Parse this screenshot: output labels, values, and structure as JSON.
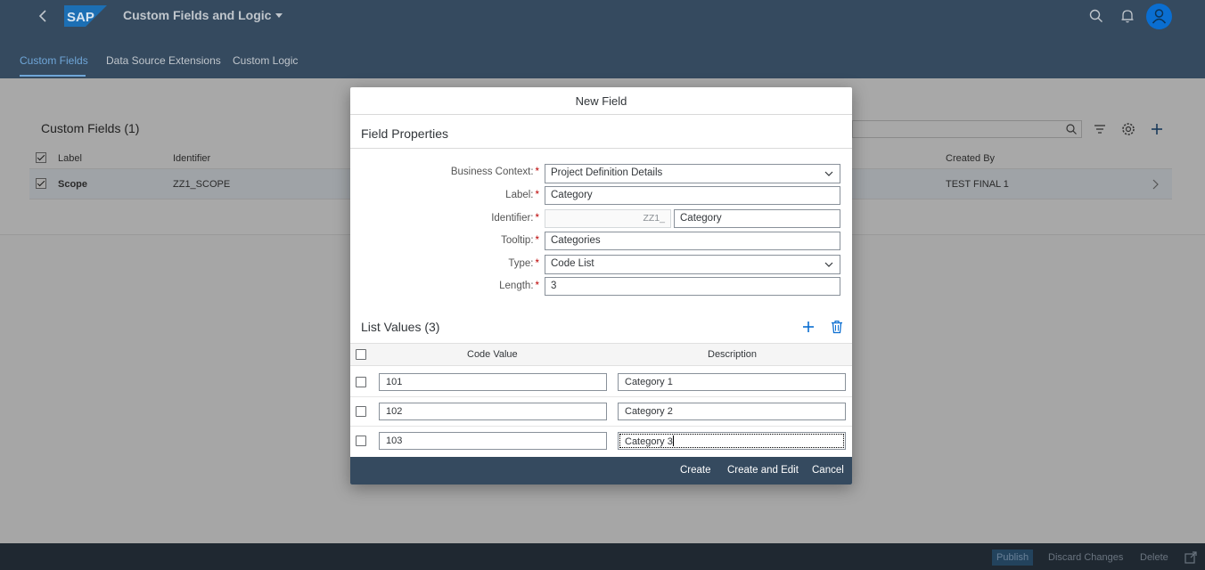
{
  "shell": {
    "app_title": "Custom Fields and Logic",
    "logo_text": "SAP"
  },
  "tabs": [
    {
      "label": "Custom Fields"
    },
    {
      "label": "Data Source Extensions"
    },
    {
      "label": "Custom Logic"
    }
  ],
  "background_table": {
    "title": "Custom Fields (1)",
    "columns": {
      "label": "Label",
      "identifier": "Identifier",
      "created_by": "Created By"
    },
    "row": {
      "label": "Scope",
      "identifier": "ZZ1_SCOPE",
      "created_by": "TEST FINAL 1"
    }
  },
  "footer": {
    "publish": "Publish",
    "discard": "Discard Changes",
    "delete": "Delete"
  },
  "dialog": {
    "title": "New Field",
    "section_title": "Field Properties",
    "fields": {
      "business_context": {
        "label": "Business Context:",
        "value": "Project Definition Details"
      },
      "label": {
        "label": "Label:",
        "value": "Category"
      },
      "identifier": {
        "label": "Identifier:",
        "prefix": "ZZ1_",
        "value": "Category"
      },
      "tooltip": {
        "label": "Tooltip:",
        "value": "Categories"
      },
      "type": {
        "label": "Type:",
        "value": "Code List"
      },
      "length": {
        "label": "Length:",
        "value": "3"
      }
    },
    "required_marker": "*",
    "list": {
      "title": "List Values (3)",
      "columns": {
        "code": "Code Value",
        "description": "Description"
      },
      "rows": [
        {
          "code": "101",
          "description": "Category 1"
        },
        {
          "code": "102",
          "description": "Category 2"
        },
        {
          "code": "103",
          "description": "Category 3"
        }
      ]
    },
    "buttons": {
      "create": "Create",
      "create_and_edit": "Create and Edit",
      "cancel": "Cancel"
    }
  },
  "colors": {
    "shell": "#354a5f",
    "accent": "#0a6ed1",
    "required": "#bb0000"
  }
}
